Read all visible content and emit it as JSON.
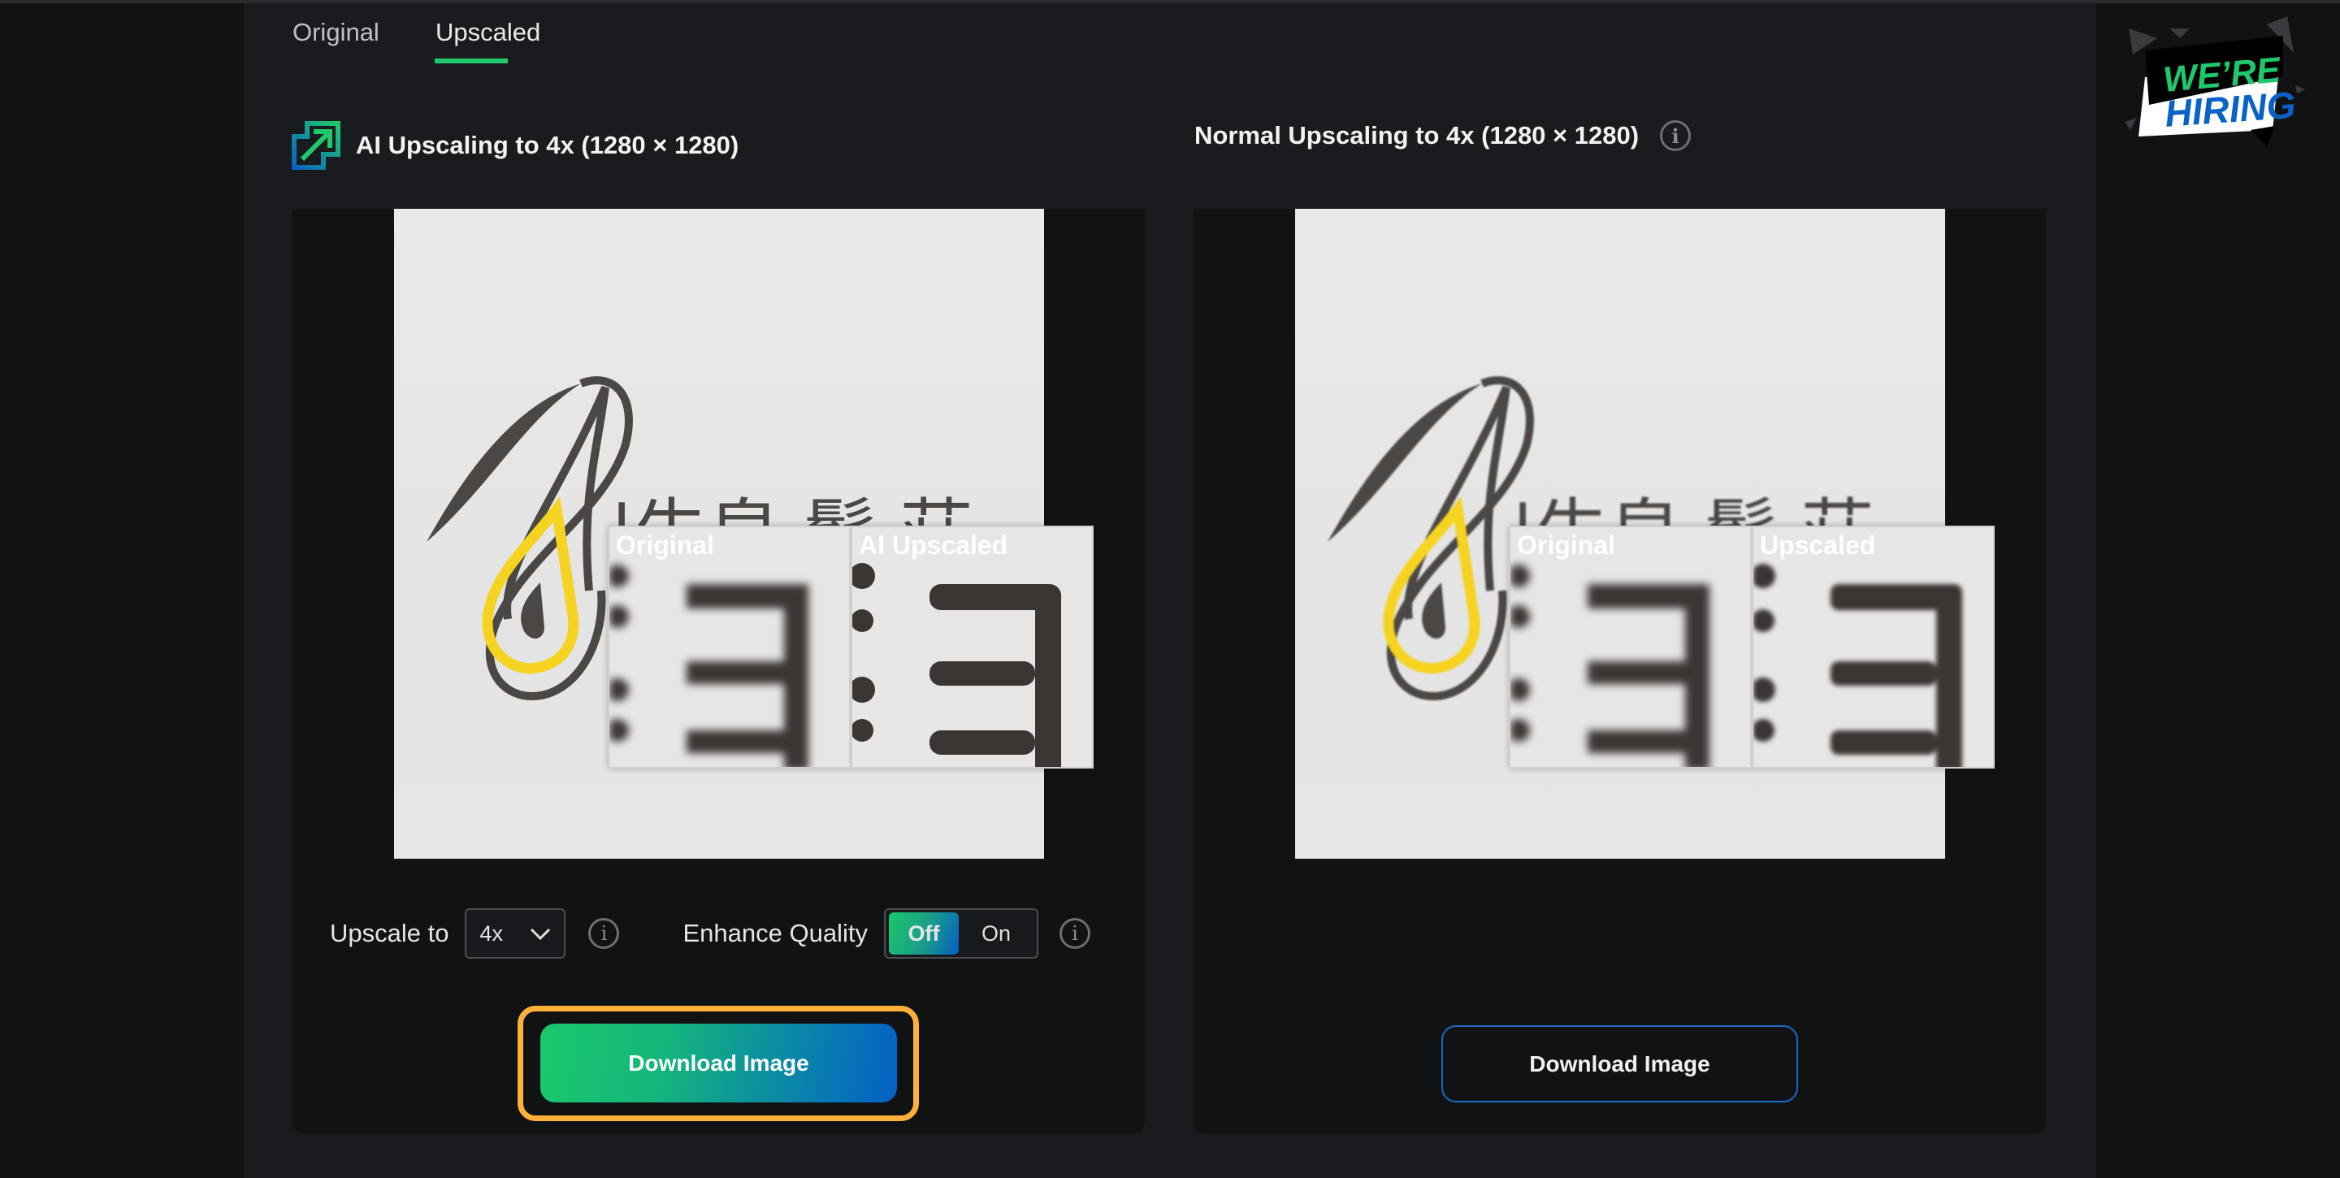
{
  "tabs": [
    {
      "label": "Original",
      "active": false
    },
    {
      "label": "Upscaled",
      "active": true
    }
  ],
  "left": {
    "title": "AI Upscaling to 4x (1280 × 1280)",
    "icon": "ai-upscale-icon",
    "inset_labels": [
      "Original",
      "AI Upscaled"
    ],
    "upscale_label": "Upscale to",
    "upscale_value": "4x",
    "enhance_label": "Enhance Quality",
    "toggle_off": "Off",
    "toggle_on": "On",
    "toggle_state": "Off",
    "download": "Download Image"
  },
  "right": {
    "title": "Normal Upscaling to 4x (1280 × 1280)",
    "inset_labels": [
      "Original",
      "Upscaled"
    ],
    "download": "Download Image"
  },
  "banner": {
    "line1": "WE’RE",
    "line2": "HIRING"
  },
  "colors": {
    "accent": "#1ec86b",
    "blue": "#0460c6",
    "focus": "#ffb038",
    "logo_yellow": "#f5d320",
    "logo_dark": "#4a4745"
  }
}
